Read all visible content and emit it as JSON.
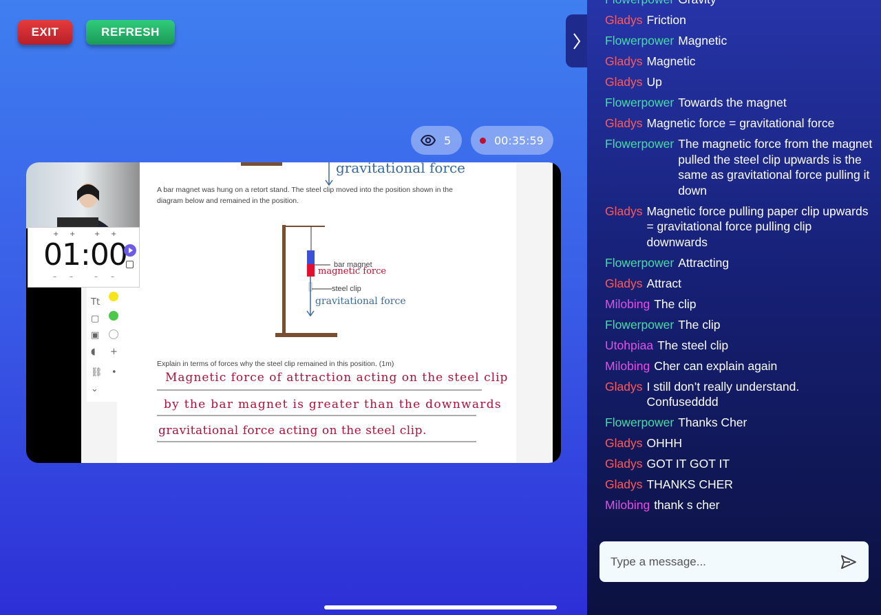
{
  "top_buttons": {
    "exit": "EXIT",
    "refresh": "REFRESH"
  },
  "stream": {
    "viewers": "5",
    "duration": "00:35:59"
  },
  "slide": {
    "question_text": "A bar magnet was hung on a retort stand. The steel clip moved into the position shown in the diagram below and remained in the position.",
    "labels": {
      "bar_magnet": "bar magnet",
      "steel_clip": "steel clip"
    },
    "handwritten": {
      "top_label": "gravitational force",
      "magnetic_label": "magnetic force",
      "gravity_label": "gravitational force",
      "answer_line1": "Magnetic force of attraction acting on the steel clip",
      "answer_line2": "by the bar magnet is greater than the downwards",
      "answer_line3": "gravitational force acting on the steel clip."
    },
    "explain_prompt": "Explain in terms of forces why the steel clip remained in this position. (1m)",
    "timer": "01:00"
  },
  "chat": {
    "name_colors": {
      "Flowerpower": "#3fe0a0",
      "Gladys": "#ff5a5a",
      "Milobing": "#e64fe6",
      "Utohpiaa": "#e64fe6"
    },
    "messages": [
      {
        "name": "Flowerpower",
        "text": "Gravity"
      },
      {
        "name": "Gladys",
        "text": "Friction"
      },
      {
        "name": "Flowerpower",
        "text": "Magnetic"
      },
      {
        "name": "Gladys",
        "text": "Magnetic"
      },
      {
        "name": "Gladys",
        "text": "Up"
      },
      {
        "name": "Flowerpower",
        "text": "Towards the magnet"
      },
      {
        "name": "Gladys",
        "text": "Magnetic force = gravitational force"
      },
      {
        "name": "Flowerpower",
        "text": "The magnetic force from the magnet pulled the steel clip upwards is the same as gravitational force pulling it down"
      },
      {
        "name": "Gladys",
        "text": "Magnetic force pulling paper clip upwards = gravitational force pulling clip downwards"
      },
      {
        "name": "Flowerpower",
        "text": "Attracting"
      },
      {
        "name": "Gladys",
        "text": "Attract"
      },
      {
        "name": "Milobing",
        "text": "The clip"
      },
      {
        "name": "Flowerpower",
        "text": "The clip"
      },
      {
        "name": "Utohpiaa",
        "text": "The steel clip"
      },
      {
        "name": "Milobing",
        "text": "Cher can explain again"
      },
      {
        "name": "Gladys",
        "text": "I still don’t really understand. Confusedddd"
      },
      {
        "name": "Flowerpower",
        "text": "Thanks Cher"
      },
      {
        "name": "Gladys",
        "text": "OHHH"
      },
      {
        "name": "Gladys",
        "text": "GOT IT GOT IT"
      },
      {
        "name": "Gladys",
        "text": "THANKS CHER"
      },
      {
        "name": "Milobing",
        "text": "thank s cher"
      }
    ],
    "input_placeholder": "Type a message..."
  }
}
